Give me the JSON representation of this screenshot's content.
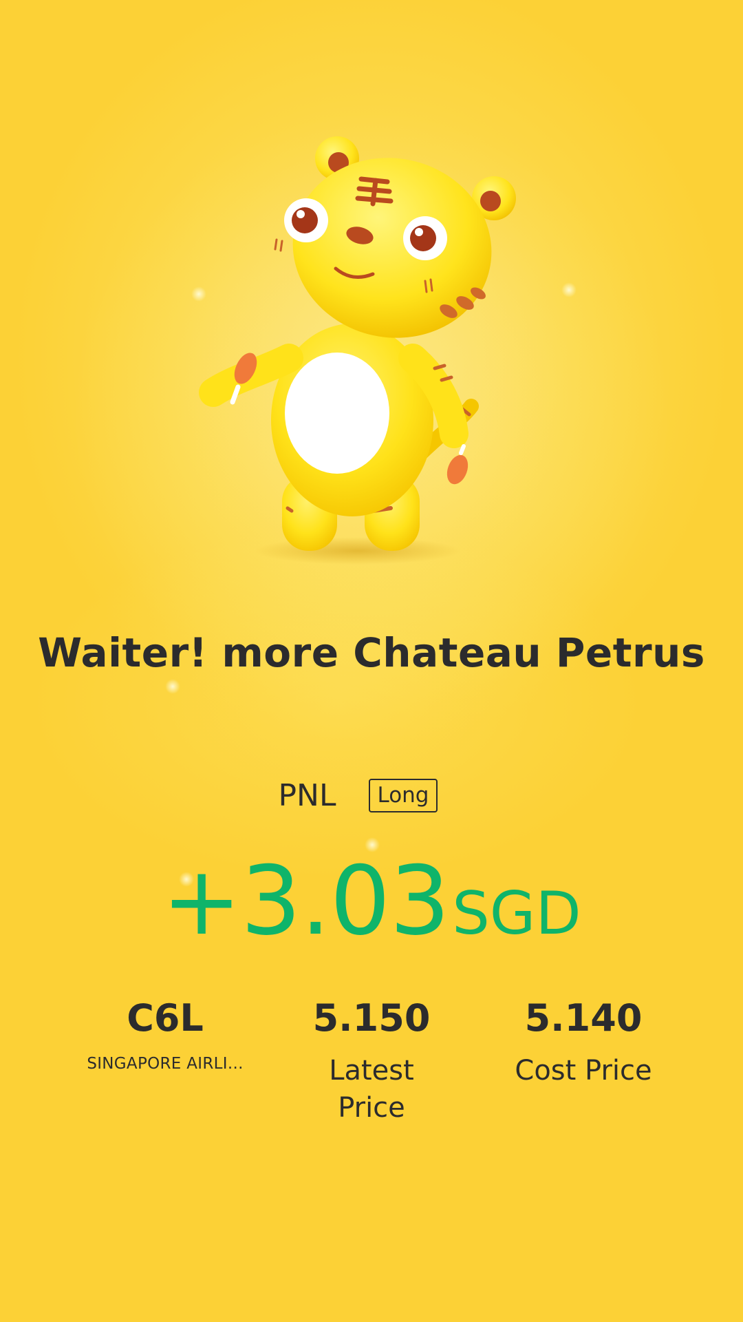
{
  "message": "Waiter! more Chateau Petrus",
  "pnl": {
    "label": "PNL",
    "position_tag": "Long",
    "value": "+3.03",
    "currency": "SGD"
  },
  "stock": {
    "code": "C6L",
    "name": "SINGAPORE AIRLI..."
  },
  "latest_price": {
    "value": "5.150",
    "label": "Latest Price"
  },
  "cost_price": {
    "value": "5.140",
    "label": "Cost Price"
  },
  "colors": {
    "background": "#fcd94a",
    "profit_green": "#0fb46a",
    "text_dark": "#2b2b2d",
    "mascot_yellow": "#ffe21a"
  },
  "icons": {
    "mascot": "tiger-mascot-illustration"
  }
}
